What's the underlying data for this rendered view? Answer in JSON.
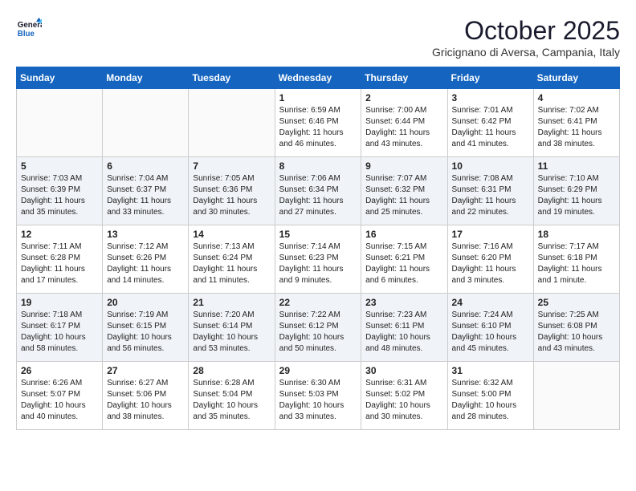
{
  "header": {
    "logo_line1": "General",
    "logo_line2": "Blue",
    "month": "October 2025",
    "location": "Gricignano di Aversa, Campania, Italy"
  },
  "weekdays": [
    "Sunday",
    "Monday",
    "Tuesday",
    "Wednesday",
    "Thursday",
    "Friday",
    "Saturday"
  ],
  "weeks": [
    [
      {
        "day": "",
        "info": ""
      },
      {
        "day": "",
        "info": ""
      },
      {
        "day": "",
        "info": ""
      },
      {
        "day": "1",
        "info": "Sunrise: 6:59 AM\nSunset: 6:46 PM\nDaylight: 11 hours\nand 46 minutes."
      },
      {
        "day": "2",
        "info": "Sunrise: 7:00 AM\nSunset: 6:44 PM\nDaylight: 11 hours\nand 43 minutes."
      },
      {
        "day": "3",
        "info": "Sunrise: 7:01 AM\nSunset: 6:42 PM\nDaylight: 11 hours\nand 41 minutes."
      },
      {
        "day": "4",
        "info": "Sunrise: 7:02 AM\nSunset: 6:41 PM\nDaylight: 11 hours\nand 38 minutes."
      }
    ],
    [
      {
        "day": "5",
        "info": "Sunrise: 7:03 AM\nSunset: 6:39 PM\nDaylight: 11 hours\nand 35 minutes."
      },
      {
        "day": "6",
        "info": "Sunrise: 7:04 AM\nSunset: 6:37 PM\nDaylight: 11 hours\nand 33 minutes."
      },
      {
        "day": "7",
        "info": "Sunrise: 7:05 AM\nSunset: 6:36 PM\nDaylight: 11 hours\nand 30 minutes."
      },
      {
        "day": "8",
        "info": "Sunrise: 7:06 AM\nSunset: 6:34 PM\nDaylight: 11 hours\nand 27 minutes."
      },
      {
        "day": "9",
        "info": "Sunrise: 7:07 AM\nSunset: 6:32 PM\nDaylight: 11 hours\nand 25 minutes."
      },
      {
        "day": "10",
        "info": "Sunrise: 7:08 AM\nSunset: 6:31 PM\nDaylight: 11 hours\nand 22 minutes."
      },
      {
        "day": "11",
        "info": "Sunrise: 7:10 AM\nSunset: 6:29 PM\nDaylight: 11 hours\nand 19 minutes."
      }
    ],
    [
      {
        "day": "12",
        "info": "Sunrise: 7:11 AM\nSunset: 6:28 PM\nDaylight: 11 hours\nand 17 minutes."
      },
      {
        "day": "13",
        "info": "Sunrise: 7:12 AM\nSunset: 6:26 PM\nDaylight: 11 hours\nand 14 minutes."
      },
      {
        "day": "14",
        "info": "Sunrise: 7:13 AM\nSunset: 6:24 PM\nDaylight: 11 hours\nand 11 minutes."
      },
      {
        "day": "15",
        "info": "Sunrise: 7:14 AM\nSunset: 6:23 PM\nDaylight: 11 hours\nand 9 minutes."
      },
      {
        "day": "16",
        "info": "Sunrise: 7:15 AM\nSunset: 6:21 PM\nDaylight: 11 hours\nand 6 minutes."
      },
      {
        "day": "17",
        "info": "Sunrise: 7:16 AM\nSunset: 6:20 PM\nDaylight: 11 hours\nand 3 minutes."
      },
      {
        "day": "18",
        "info": "Sunrise: 7:17 AM\nSunset: 6:18 PM\nDaylight: 11 hours\nand 1 minute."
      }
    ],
    [
      {
        "day": "19",
        "info": "Sunrise: 7:18 AM\nSunset: 6:17 PM\nDaylight: 10 hours\nand 58 minutes."
      },
      {
        "day": "20",
        "info": "Sunrise: 7:19 AM\nSunset: 6:15 PM\nDaylight: 10 hours\nand 56 minutes."
      },
      {
        "day": "21",
        "info": "Sunrise: 7:20 AM\nSunset: 6:14 PM\nDaylight: 10 hours\nand 53 minutes."
      },
      {
        "day": "22",
        "info": "Sunrise: 7:22 AM\nSunset: 6:12 PM\nDaylight: 10 hours\nand 50 minutes."
      },
      {
        "day": "23",
        "info": "Sunrise: 7:23 AM\nSunset: 6:11 PM\nDaylight: 10 hours\nand 48 minutes."
      },
      {
        "day": "24",
        "info": "Sunrise: 7:24 AM\nSunset: 6:10 PM\nDaylight: 10 hours\nand 45 minutes."
      },
      {
        "day": "25",
        "info": "Sunrise: 7:25 AM\nSunset: 6:08 PM\nDaylight: 10 hours\nand 43 minutes."
      }
    ],
    [
      {
        "day": "26",
        "info": "Sunrise: 6:26 AM\nSunset: 5:07 PM\nDaylight: 10 hours\nand 40 minutes."
      },
      {
        "day": "27",
        "info": "Sunrise: 6:27 AM\nSunset: 5:06 PM\nDaylight: 10 hours\nand 38 minutes."
      },
      {
        "day": "28",
        "info": "Sunrise: 6:28 AM\nSunset: 5:04 PM\nDaylight: 10 hours\nand 35 minutes."
      },
      {
        "day": "29",
        "info": "Sunrise: 6:30 AM\nSunset: 5:03 PM\nDaylight: 10 hours\nand 33 minutes."
      },
      {
        "day": "30",
        "info": "Sunrise: 6:31 AM\nSunset: 5:02 PM\nDaylight: 10 hours\nand 30 minutes."
      },
      {
        "day": "31",
        "info": "Sunrise: 6:32 AM\nSunset: 5:00 PM\nDaylight: 10 hours\nand 28 minutes."
      },
      {
        "day": "",
        "info": ""
      }
    ]
  ]
}
